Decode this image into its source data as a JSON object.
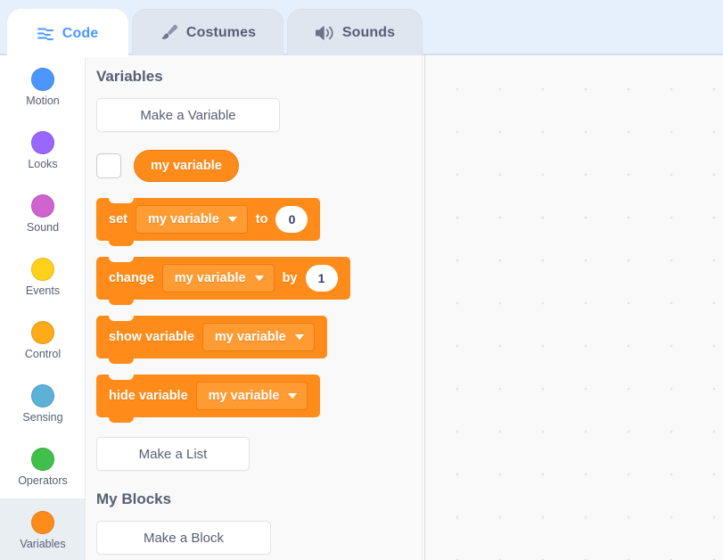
{
  "tabs": [
    {
      "id": "code",
      "label": "Code",
      "icon": "code-blocks-icon",
      "active": true
    },
    {
      "id": "costumes",
      "label": "Costumes",
      "icon": "paintbrush-icon",
      "active": false
    },
    {
      "id": "sounds",
      "label": "Sounds",
      "icon": "speaker-icon",
      "active": false
    }
  ],
  "categories": [
    {
      "id": "motion",
      "label": "Motion",
      "color": "#4C97FF",
      "selected": false
    },
    {
      "id": "looks",
      "label": "Looks",
      "color": "#9966FF",
      "selected": false
    },
    {
      "id": "sound",
      "label": "Sound",
      "color": "#CF63CF",
      "selected": false
    },
    {
      "id": "events",
      "label": "Events",
      "color": "#FFD11A",
      "selected": false
    },
    {
      "id": "control",
      "label": "Control",
      "color": "#FFAB19",
      "selected": false
    },
    {
      "id": "sensing",
      "label": "Sensing",
      "color": "#5CB1D6",
      "selected": false
    },
    {
      "id": "operators",
      "label": "Operators",
      "color": "#40BF4A",
      "selected": false
    },
    {
      "id": "variables",
      "label": "Variables",
      "color": "#FF8C1A",
      "selected": true
    }
  ],
  "palette": {
    "variables_heading": "Variables",
    "make_a_variable": "Make a Variable",
    "make_a_list": "Make a List",
    "my_blocks_heading": "My Blocks",
    "make_a_block": "Make a Block",
    "variable_name": "my variable",
    "blocks": {
      "set": {
        "label": "set",
        "dropdown": "my variable",
        "connector": "to",
        "value": "0"
      },
      "change": {
        "label": "change",
        "dropdown": "my variable",
        "connector": "by",
        "value": "1"
      },
      "show": {
        "label": "show variable",
        "dropdown": "my variable"
      },
      "hide": {
        "label": "hide variable",
        "dropdown": "my variable"
      }
    }
  },
  "theme": {
    "variables_color": "#FF8C1A",
    "variables_field": "#FF9B33",
    "accent_blue": "#4C97FF",
    "text_grey": "#575E75",
    "header_bg": "#E6EFFC",
    "palette_bg": "#F9F9F9"
  }
}
